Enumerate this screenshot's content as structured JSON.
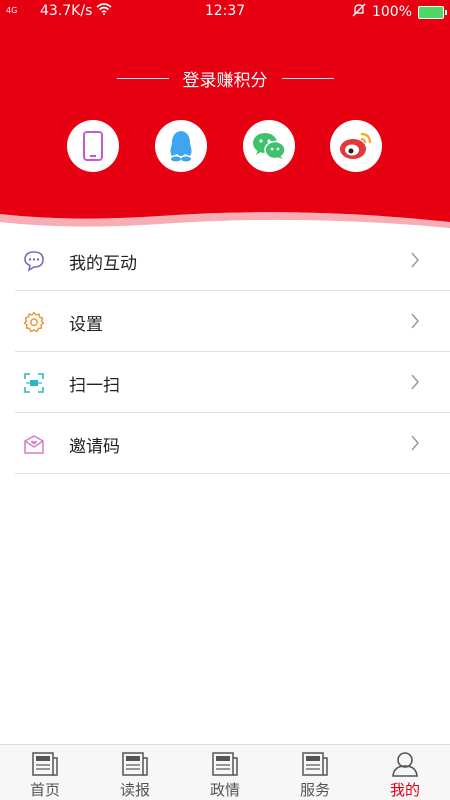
{
  "status_bar": {
    "signal": "4G",
    "speed": "43.7K/s",
    "time": "12:37",
    "battery": "100%"
  },
  "header": {
    "title": "登录赚积分",
    "bg_color": "#e60012",
    "social": [
      {
        "name": "phone-icon",
        "color": "#c45bd0"
      },
      {
        "name": "qq-icon",
        "color": "#3ea6f0"
      },
      {
        "name": "wechat-icon",
        "color": "#3fc26c"
      },
      {
        "name": "weibo-icon",
        "color": "#e3373a"
      }
    ]
  },
  "menu": {
    "items": [
      {
        "label": "我的互动",
        "icon": "chat-bubble-icon"
      },
      {
        "label": "设置",
        "icon": "settings-gear-icon"
      },
      {
        "label": "扫一扫",
        "icon": "scan-icon"
      },
      {
        "label": "邀请码",
        "icon": "invite-envelope-icon"
      }
    ]
  },
  "tabbar": {
    "tabs": [
      {
        "label": "首页",
        "icon": "news-icon"
      },
      {
        "label": "读报",
        "icon": "news-icon"
      },
      {
        "label": "政情",
        "icon": "news-icon"
      },
      {
        "label": "服务",
        "icon": "news-icon"
      },
      {
        "label": "我的",
        "icon": "user-icon"
      }
    ],
    "active": "我的",
    "active_color": "#e60012"
  }
}
